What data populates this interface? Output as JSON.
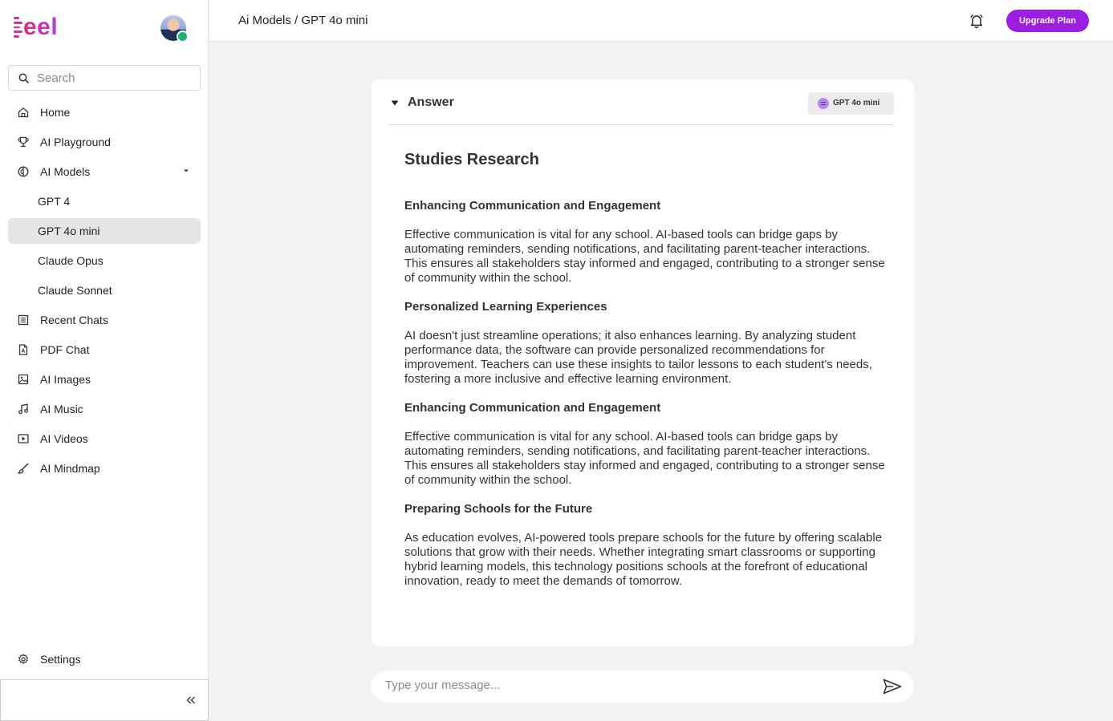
{
  "app": {
    "logo_text": "eel",
    "brand_gradient": [
      "#e0287a",
      "#b63be0"
    ],
    "accent": "#9b1fe0",
    "online_status_color": "#1fb36b"
  },
  "sidebar": {
    "search_placeholder": "Search",
    "items": [
      {
        "label": "Home",
        "icon": "home-icon"
      },
      {
        "label": "AI Playground",
        "icon": "trophy-icon"
      },
      {
        "label": "AI Models",
        "icon": "models-icon",
        "expanded": true
      },
      {
        "label": "GPT 4",
        "sub": true
      },
      {
        "label": "GPT 4o mini",
        "sub": true,
        "active": true
      },
      {
        "label": "Claude Opus",
        "sub": true
      },
      {
        "label": "Claude Sonnet",
        "sub": true
      },
      {
        "label": "Recent Chats",
        "icon": "list-icon"
      },
      {
        "label": "PDF Chat",
        "icon": "pdf-icon"
      },
      {
        "label": "AI Images",
        "icon": "image-icon"
      },
      {
        "label": "AI Music",
        "icon": "music-icon"
      },
      {
        "label": "AI Videos",
        "icon": "video-icon"
      },
      {
        "label": "AI Mindmap",
        "icon": "brush-icon"
      }
    ],
    "settings_label": "Settings",
    "collapse_icon": "double-chevron-left-icon"
  },
  "header": {
    "breadcrumb": "Ai Models / GPT 4o mini",
    "upgrade_label": "Upgrade Plan",
    "bell_icon": "bell-icon"
  },
  "answer": {
    "section_label": "Answer",
    "model_chip": "GPT 4o mini",
    "title": "Studies Research",
    "sections": [
      {
        "heading": "Enhancing Communication and Engagement",
        "body": "Effective communication is vital for any school. AI-based tools can bridge gaps by automating reminders, sending notifications, and facilitating parent-teacher interactions. This ensures all stakeholders stay informed and engaged, contributing to a stronger sense of community within the school."
      },
      {
        "heading": "Personalized Learning Experiences",
        "body": "AI doesn't just streamline operations; it also enhances learning. By analyzing student performance data, the software can provide personalized recommendations for improvement. Teachers can use these insights to tailor lessons to each student's needs, fostering a more inclusive and effective learning environment."
      },
      {
        "heading": "Enhancing Communication and Engagement",
        "body": "Effective communication is vital for any school. AI-based tools can bridge gaps by automating reminders, sending notifications, and facilitating parent-teacher interactions. This ensures all stakeholders stay informed and engaged, contributing to a stronger sense of community within the school."
      },
      {
        "heading": "Preparing Schools for the Future",
        "body": "As education evolves, AI-powered tools prepare schools for the future by offering scalable solutions that grow with their needs. Whether integrating smart classrooms or supporting hybrid learning models, this technology positions schools at the forefront of educational innovation, ready to meet the demands of tomorrow."
      }
    ]
  },
  "composer": {
    "placeholder": "Type your message...",
    "send_icon": "send-icon"
  }
}
